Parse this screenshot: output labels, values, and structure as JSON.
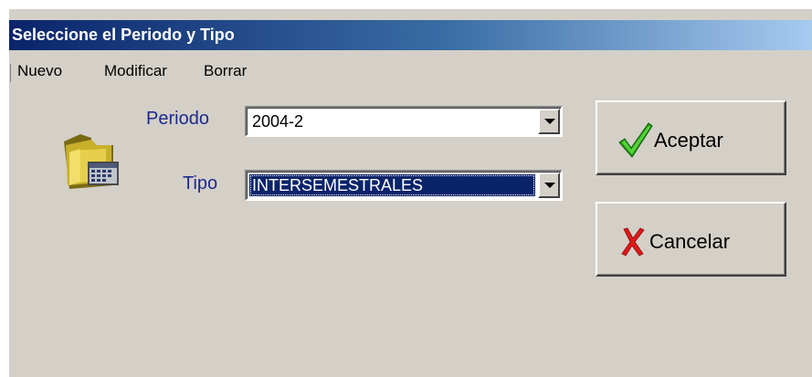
{
  "window": {
    "title": "Seleccione el Periodo y Tipo"
  },
  "menu": {
    "items": [
      "Nuevo",
      "Modificar",
      "Borrar"
    ]
  },
  "form": {
    "periodo": {
      "label": "Periodo",
      "value": "2004-2"
    },
    "tipo": {
      "label": "Tipo",
      "value": "INTERSEMESTRALES"
    }
  },
  "buttons": {
    "accept": "Aceptar",
    "cancel": "Cancelar"
  },
  "icons": {
    "folder": "folder-calendar-icon",
    "accept": "checkmark-icon",
    "cancel": "x-mark-icon"
  },
  "colors": {
    "title_start": "#0a246a",
    "title_end": "#a6caf0",
    "label": "#1c2a8c",
    "selection": "#0a246a",
    "check": "#2a9d1a",
    "cross": "#e01818"
  }
}
